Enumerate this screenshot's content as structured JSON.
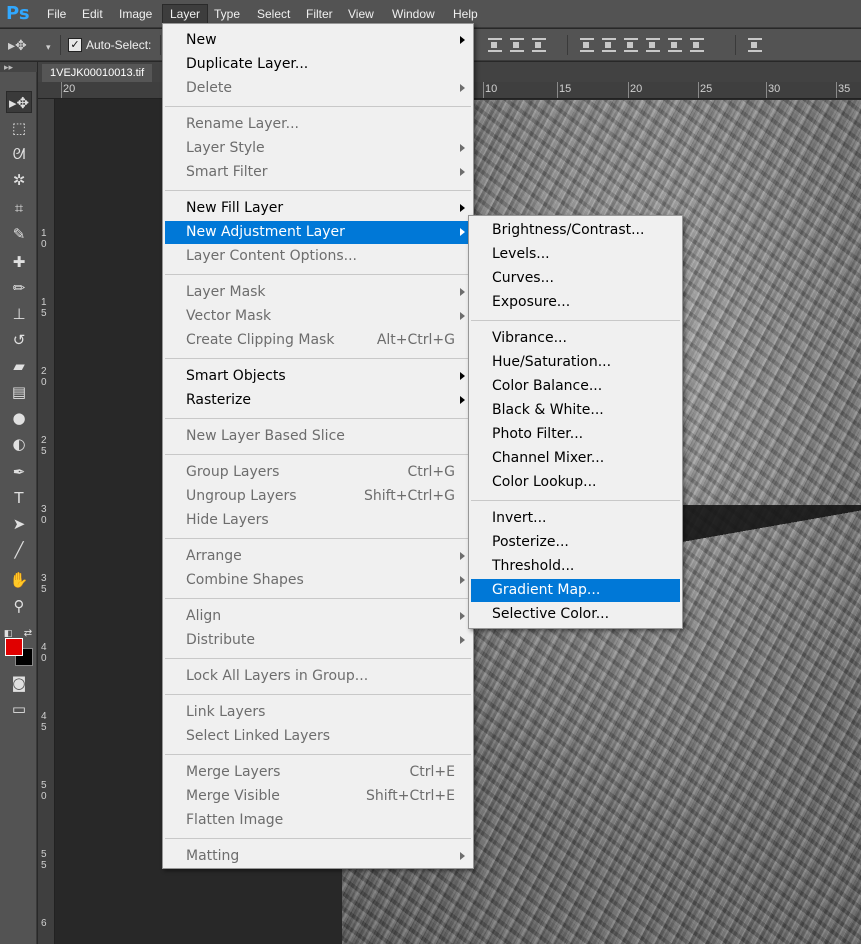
{
  "app": {
    "logo": "Ps"
  },
  "menubar": {
    "items": [
      "File",
      "Edit",
      "Image",
      "Layer",
      "Type",
      "Select",
      "Filter",
      "View",
      "Window",
      "Help"
    ],
    "active": "Layer"
  },
  "options": {
    "tool_icon": "move-icon",
    "auto_select_label": "Auto-Select:",
    "auto_select_checked": true
  },
  "document": {
    "tab_title": "1VEJK00010013.tif",
    "ruler_h": [
      "20",
      "10",
      "15",
      "20",
      "25",
      "30",
      "35"
    ],
    "ruler_v": [
      [
        "1",
        "0"
      ],
      [
        "1",
        "5"
      ],
      [
        "2",
        "0"
      ],
      [
        "2",
        "5"
      ],
      [
        "3",
        "0"
      ],
      [
        "3",
        "5"
      ],
      [
        "4",
        "0"
      ],
      [
        "4",
        "5"
      ],
      [
        "5",
        "0"
      ],
      [
        "5",
        "5"
      ],
      [
        "6"
      ]
    ]
  },
  "layer_menu": {
    "groups": [
      [
        {
          "label": "New",
          "submenu": true,
          "enabled": true
        },
        {
          "label": "Duplicate Layer...",
          "enabled": true
        },
        {
          "label": "Delete",
          "submenu": true,
          "enabled": false
        }
      ],
      [
        {
          "label": "Rename Layer...",
          "enabled": false
        },
        {
          "label": "Layer Style",
          "submenu": true,
          "enabled": false
        },
        {
          "label": "Smart Filter",
          "submenu": true,
          "enabled": false
        }
      ],
      [
        {
          "label": "New Fill Layer",
          "submenu": true,
          "enabled": true
        },
        {
          "label": "New Adjustment Layer",
          "submenu": true,
          "enabled": true,
          "highlighted": true
        },
        {
          "label": "Layer Content Options...",
          "enabled": false
        }
      ],
      [
        {
          "label": "Layer Mask",
          "submenu": true,
          "enabled": false
        },
        {
          "label": "Vector Mask",
          "submenu": true,
          "enabled": false
        },
        {
          "label": "Create Clipping Mask",
          "shortcut": "Alt+Ctrl+G",
          "enabled": false
        }
      ],
      [
        {
          "label": "Smart Objects",
          "submenu": true,
          "enabled": true
        },
        {
          "label": "Rasterize",
          "submenu": true,
          "enabled": true
        }
      ],
      [
        {
          "label": "New Layer Based Slice",
          "enabled": false
        }
      ],
      [
        {
          "label": "Group Layers",
          "shortcut": "Ctrl+G",
          "enabled": false
        },
        {
          "label": "Ungroup Layers",
          "shortcut": "Shift+Ctrl+G",
          "enabled": false
        },
        {
          "label": "Hide Layers",
          "enabled": false
        }
      ],
      [
        {
          "label": "Arrange",
          "submenu": true,
          "enabled": false
        },
        {
          "label": "Combine Shapes",
          "submenu": true,
          "enabled": false
        }
      ],
      [
        {
          "label": "Align",
          "submenu": true,
          "enabled": false
        },
        {
          "label": "Distribute",
          "submenu": true,
          "enabled": false
        }
      ],
      [
        {
          "label": "Lock All Layers in Group...",
          "enabled": false
        }
      ],
      [
        {
          "label": "Link Layers",
          "enabled": false
        },
        {
          "label": "Select Linked Layers",
          "enabled": false
        }
      ],
      [
        {
          "label": "Merge Layers",
          "shortcut": "Ctrl+E",
          "enabled": false
        },
        {
          "label": "Merge Visible",
          "shortcut": "Shift+Ctrl+E",
          "enabled": false
        },
        {
          "label": "Flatten Image",
          "enabled": false
        }
      ],
      [
        {
          "label": "Matting",
          "submenu": true,
          "enabled": false
        }
      ]
    ]
  },
  "adjustment_menu": {
    "groups": [
      [
        {
          "label": "Brightness/Contrast..."
        },
        {
          "label": "Levels..."
        },
        {
          "label": "Curves..."
        },
        {
          "label": "Exposure..."
        }
      ],
      [
        {
          "label": "Vibrance..."
        },
        {
          "label": "Hue/Saturation..."
        },
        {
          "label": "Color Balance..."
        },
        {
          "label": "Black & White..."
        },
        {
          "label": "Photo Filter..."
        },
        {
          "label": "Channel Mixer..."
        },
        {
          "label": "Color Lookup..."
        }
      ],
      [
        {
          "label": "Invert..."
        },
        {
          "label": "Posterize..."
        },
        {
          "label": "Threshold..."
        },
        {
          "label": "Gradient Map...",
          "highlighted": true
        },
        {
          "label": "Selective Color..."
        }
      ]
    ]
  },
  "tools": [
    {
      "name": "move-tool",
      "glyph": "▸✥",
      "active": true
    },
    {
      "name": "marquee-tool",
      "glyph": "⬚"
    },
    {
      "name": "lasso-tool",
      "glyph": "ᘛ"
    },
    {
      "name": "quick-selection-tool",
      "glyph": "✲"
    },
    {
      "name": "crop-tool",
      "glyph": "⌗"
    },
    {
      "name": "eyedropper-tool",
      "glyph": "✎"
    },
    {
      "name": "healing-brush-tool",
      "glyph": "✚"
    },
    {
      "name": "brush-tool",
      "glyph": "✏"
    },
    {
      "name": "clone-stamp-tool",
      "glyph": "⊥"
    },
    {
      "name": "history-brush-tool",
      "glyph": "↺"
    },
    {
      "name": "eraser-tool",
      "glyph": "▰"
    },
    {
      "name": "gradient-tool",
      "glyph": "▤"
    },
    {
      "name": "blur-tool",
      "glyph": "●"
    },
    {
      "name": "dodge-tool",
      "glyph": "◐"
    },
    {
      "name": "pen-tool",
      "glyph": "✒"
    },
    {
      "name": "type-tool",
      "glyph": "T"
    },
    {
      "name": "path-selection-tool",
      "glyph": "➤"
    },
    {
      "name": "line-tool",
      "glyph": "╱"
    },
    {
      "name": "hand-tool",
      "glyph": "✋"
    },
    {
      "name": "zoom-tool",
      "glyph": "⚲"
    }
  ],
  "colors": {
    "foreground": "#e00000",
    "background": "#000000",
    "menu_highlight": "#0078d7"
  }
}
